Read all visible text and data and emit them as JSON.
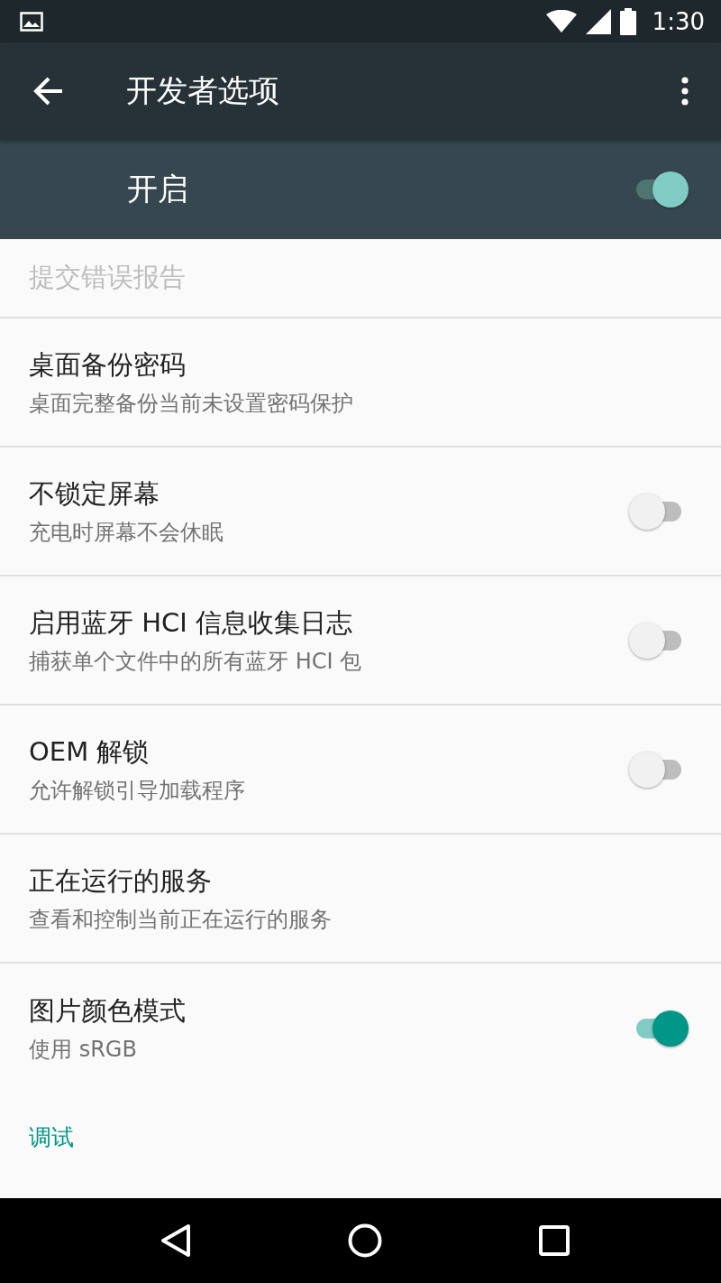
{
  "status_bar": {
    "time": "1:30"
  },
  "toolbar": {
    "title": "开发者选项"
  },
  "master_switch": {
    "label": "开启",
    "on": true
  },
  "preferences": [
    {
      "kind": "plain",
      "title": "提交错误报告",
      "disabled": true
    },
    {
      "kind": "plain",
      "title": "桌面备份密码",
      "summary": "桌面完整备份当前未设置密码保护",
      "disabled": false
    },
    {
      "kind": "switch",
      "title": "不锁定屏幕",
      "summary": "充电时屏幕不会休眠",
      "on": false,
      "disabled": false
    },
    {
      "kind": "switch",
      "title": "启用蓝牙 HCI 信息收集日志",
      "summary": "捕获单个文件中的所有蓝牙 HCI 包",
      "on": false,
      "disabled": false
    },
    {
      "kind": "switch",
      "title": "OEM 解锁",
      "summary": "允许解锁引导加载程序",
      "on": false,
      "disabled": false
    },
    {
      "kind": "plain",
      "title": "正在运行的服务",
      "summary": "查看和控制当前正在运行的服务",
      "disabled": false
    },
    {
      "kind": "switch",
      "title": "图片颜色模式",
      "summary": "使用 sRGB",
      "on": true,
      "disabled": false
    },
    {
      "kind": "category",
      "title": "调试"
    }
  ]
}
